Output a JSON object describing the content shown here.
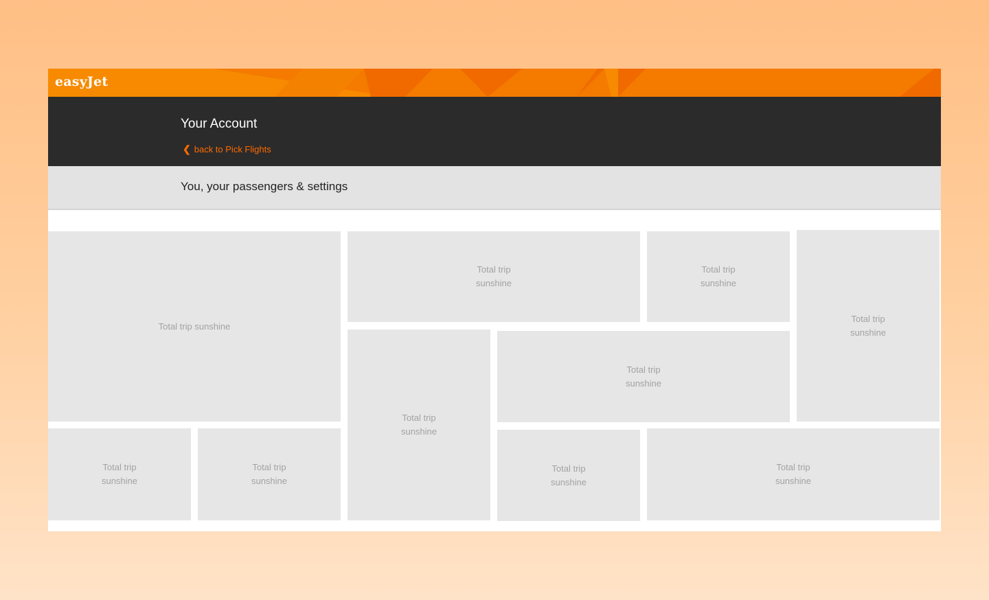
{
  "brand": {
    "logo_text": "easyJet",
    "accent": "#ff6a00",
    "bar_color": "#f47a00"
  },
  "account": {
    "title": "Your Account",
    "back_link": "back to Pick Flights"
  },
  "section": {
    "title": "You, your passengers & settings"
  },
  "tiles": [
    {
      "label": "Total trip sunshine"
    },
    {
      "label": "Total trip sunshine"
    },
    {
      "label": "Total trip sunshine"
    },
    {
      "label": "Total trip sunshine"
    },
    {
      "label": "Total trip sunshine"
    },
    {
      "label": "Total trip sunshine"
    },
    {
      "label": "Total trip sunshine"
    },
    {
      "label": "Total trip sunshine"
    },
    {
      "label": "Total trip sunshine"
    },
    {
      "label": "Total trip sunshine"
    }
  ]
}
